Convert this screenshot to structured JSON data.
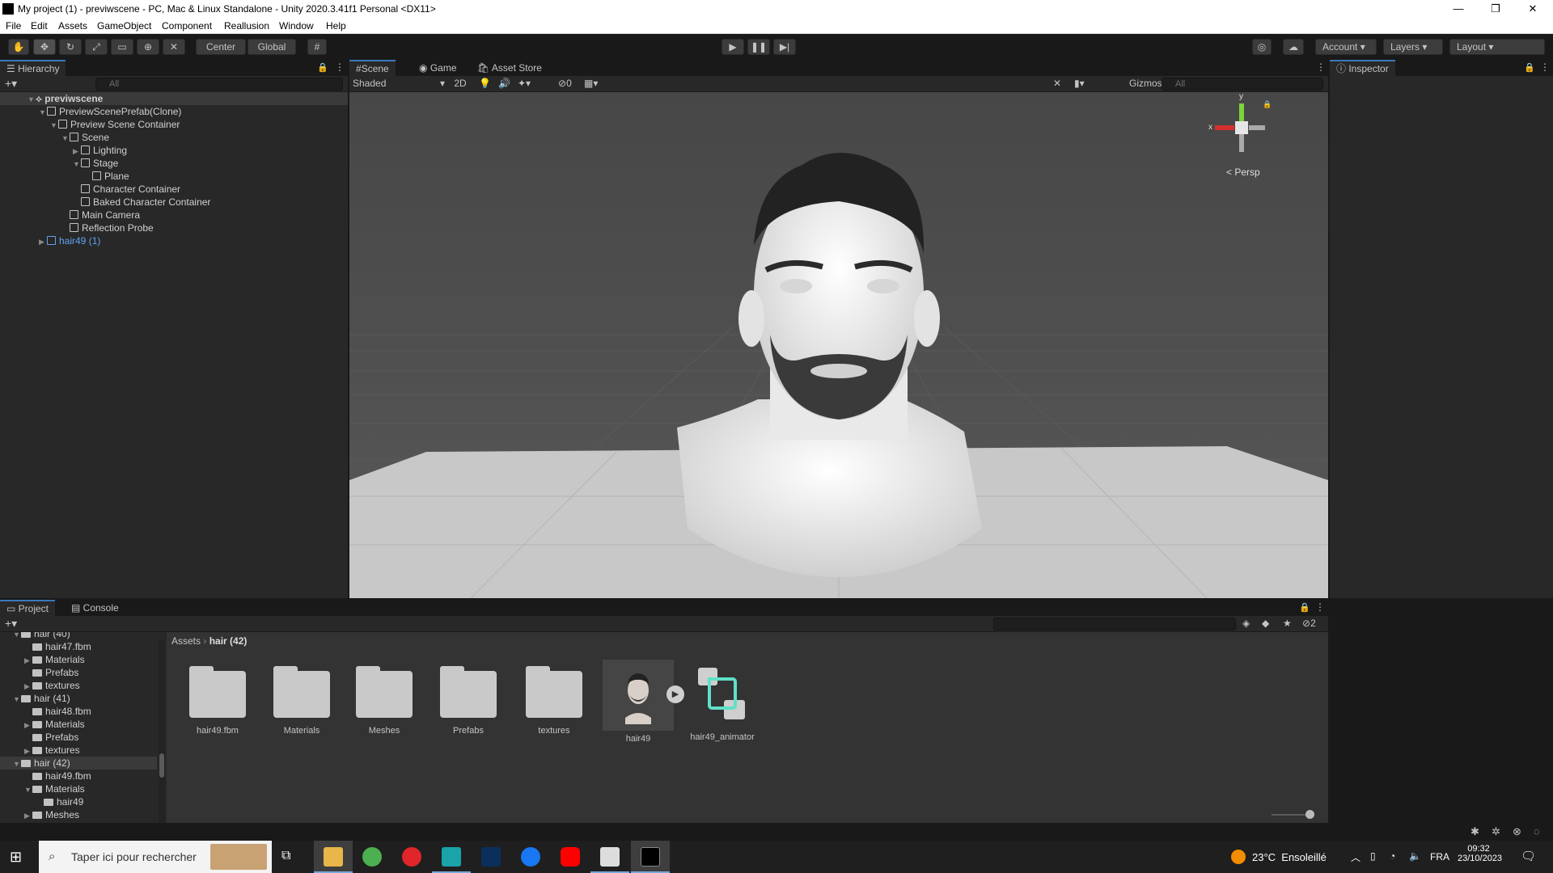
{
  "window": {
    "title": "My project (1) - previwscene - PC, Mac & Linux Standalone - Unity 2020.3.41f1 Personal <DX11>",
    "minimize": "—",
    "maximize": "❐",
    "close": "✕"
  },
  "menu": [
    "File",
    "Edit",
    "Assets",
    "GameObject",
    "Component",
    "Reallusion",
    "Window",
    "Help"
  ],
  "toolbar": {
    "center": "Center",
    "global": "Global",
    "account": "Account",
    "layers": "Layers",
    "layout": "Layout"
  },
  "hierarchy": {
    "tab": "Hierarchy",
    "search_placeholder": "All",
    "rows": [
      {
        "label": "previwscene",
        "depth": 0
      },
      {
        "label": "PreviewScenePrefab(Clone)",
        "depth": 1
      },
      {
        "label": "Preview Scene Container",
        "depth": 2
      },
      {
        "label": "Scene",
        "depth": 3
      },
      {
        "label": "Lighting",
        "depth": 4
      },
      {
        "label": "Stage",
        "depth": 4
      },
      {
        "label": "Plane",
        "depth": 5
      },
      {
        "label": "Character Container",
        "depth": 4
      },
      {
        "label": "Baked Character Container",
        "depth": 4
      },
      {
        "label": "Main Camera",
        "depth": 3
      },
      {
        "label": "Reflection Probe",
        "depth": 3
      },
      {
        "label": "hair49 (1)",
        "depth": 1
      }
    ]
  },
  "scene": {
    "tabs": [
      "Scene",
      "Game",
      "Asset Store"
    ],
    "shading": "Shaded",
    "mode2d": "2D",
    "hidden_count": "0",
    "gizmos": "Gizmos",
    "search_placeholder": "All",
    "persp": "< Persp",
    "axis_x": "x",
    "axis_y": "y"
  },
  "inspector": {
    "tab": "Inspector"
  },
  "project": {
    "tabs": [
      "Project",
      "Console"
    ],
    "hidden_count": "2",
    "tree": [
      {
        "label": "hair (40)",
        "depth": 0
      },
      {
        "label": "hair47.fbm",
        "depth": 1
      },
      {
        "label": "Materials",
        "depth": 1
      },
      {
        "label": "Prefabs",
        "depth": 1
      },
      {
        "label": "textures",
        "depth": 1
      },
      {
        "label": "hair (41)",
        "depth": 0
      },
      {
        "label": "hair48.fbm",
        "depth": 1
      },
      {
        "label": "Materials",
        "depth": 1
      },
      {
        "label": "Prefabs",
        "depth": 1
      },
      {
        "label": "textures",
        "depth": 1
      },
      {
        "label": "hair (42)",
        "depth": 0
      },
      {
        "label": "hair49.fbm",
        "depth": 1
      },
      {
        "label": "Materials",
        "depth": 1
      },
      {
        "label": "hair49",
        "depth": 2
      },
      {
        "label": "Meshes",
        "depth": 1
      }
    ],
    "breadcrumb": [
      "Assets",
      "hair (42)"
    ],
    "assets": [
      "hair49.fbm",
      "Materials",
      "Meshes",
      "Prefabs",
      "textures",
      "hair49",
      "hair49_animator"
    ]
  },
  "taskbar": {
    "search_placeholder": "Taper ici pour rechercher",
    "weather": "23°C  Ensoleillé",
    "lang": "FRA",
    "time": "09:32",
    "date": "23/10/2023"
  }
}
